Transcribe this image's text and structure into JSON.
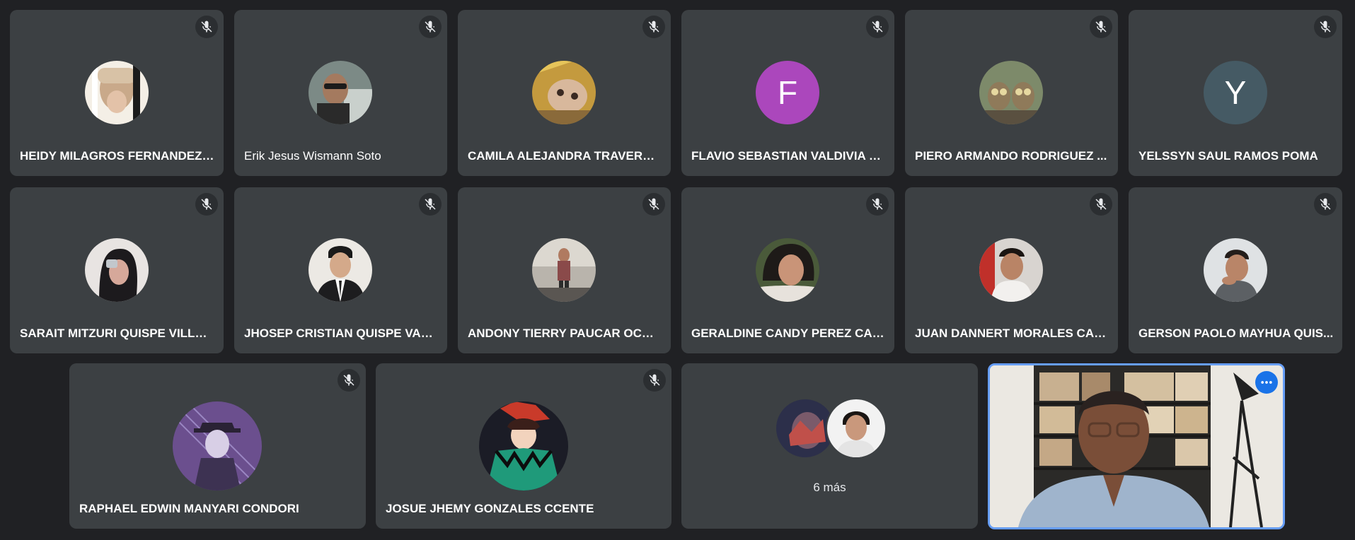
{
  "participants": [
    {
      "name": "HEIDY MILAGROS FERNANDEZ ...",
      "avatar": "photo",
      "muted": true
    },
    {
      "name": "Erik Jesus Wismann Soto",
      "avatar": "photo",
      "muted": true
    },
    {
      "name": "CAMILA ALEJANDRA TRAVERSO...",
      "avatar": "photo",
      "muted": true
    },
    {
      "name": "FLAVIO SEBASTIAN VALDIVIA ES...",
      "avatar": "letter",
      "letter": "F",
      "avatar_color": "#ab47bc",
      "muted": true
    },
    {
      "name": "PIERO ARMANDO RODRIGUEZ ...",
      "avatar": "photo",
      "muted": true
    },
    {
      "name": "YELSSYN SAUL RAMOS POMA",
      "avatar": "letter",
      "letter": "Y",
      "avatar_color": "#455a64",
      "muted": true
    },
    {
      "name": "SARAIT MITZURI QUISPE VILLAL...",
      "avatar": "photo",
      "muted": true
    },
    {
      "name": "JHOSEP CRISTIAN QUISPE VAS...",
      "avatar": "photo",
      "muted": true
    },
    {
      "name": "ANDONY TIERRY PAUCAR OCHOA",
      "avatar": "photo",
      "muted": true
    },
    {
      "name": "GERALDINE CANDY PEREZ CAR...",
      "avatar": "photo",
      "muted": true
    },
    {
      "name": "JUAN DANNERT MORALES CAM...",
      "avatar": "photo",
      "muted": true
    },
    {
      "name": "GERSON PAOLO MAYHUA QUIS...",
      "avatar": "photo",
      "muted": true
    },
    {
      "name": "RAPHAEL EDWIN MANYARI CONDORI",
      "avatar": "photo",
      "muted": true
    },
    {
      "name": "JOSUE JHEMY GONZALES CCENTE",
      "avatar": "photo",
      "muted": true
    }
  ],
  "overflow": {
    "label": "6 más"
  },
  "self_view": {
    "options_icon": "more-horiz-icon"
  },
  "icons": {
    "mic_off": "mic-off-icon"
  },
  "colors": {
    "background": "#202124",
    "tile": "#3c4043",
    "accent": "#1a73e8",
    "self_border": "#669df6"
  }
}
